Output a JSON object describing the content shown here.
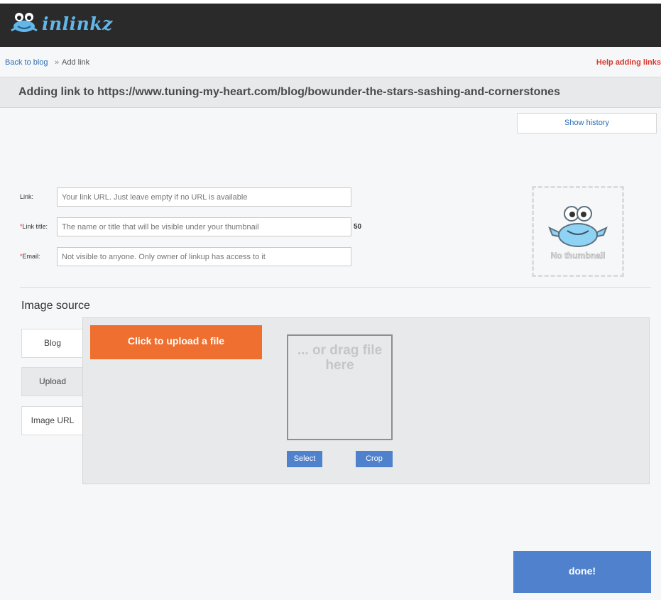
{
  "header": {
    "logo_text": "inlinkz"
  },
  "breadcrumb": {
    "back_label": "Back to blog",
    "separator": "»",
    "current": "Add link",
    "help_label": "Help adding links"
  },
  "page": {
    "title": "Adding link to https://www.tuning-my-heart.com/blog/bowunder-the-stars-sashing-and-cornerstones"
  },
  "history_button": "Show history",
  "form": {
    "link": {
      "label": "Link:",
      "required": false,
      "placeholder": "Your link URL. Just leave empty if no URL is available"
    },
    "title": {
      "label": "Link title:",
      "required": true,
      "placeholder": "The name or title that will be visible under your thumbnail",
      "counter": "50"
    },
    "email": {
      "label": "Email:",
      "required": true,
      "placeholder": "Not visible to anyone. Only owner of linkup has access to it"
    },
    "required_marker": "*"
  },
  "thumbnail": {
    "text": "No thumbnail",
    "icon": "frog-icon"
  },
  "image_source": {
    "title": "Image source",
    "tabs": [
      {
        "label": "Blog",
        "active": false
      },
      {
        "label": "Upload",
        "active": true
      },
      {
        "label": "Image URL",
        "active": false
      }
    ],
    "upload_button": "Click to upload a file",
    "drop_text": "... or drag file here",
    "select_button": "Select",
    "crop_button": "Crop"
  },
  "done_button": "done!",
  "colors": {
    "accent_orange": "#ee6f2f",
    "button_blue": "#4f81cd",
    "link_blue": "#2b6fb6",
    "help_red": "#d9362b",
    "logo_blue": "#63b6e8"
  }
}
